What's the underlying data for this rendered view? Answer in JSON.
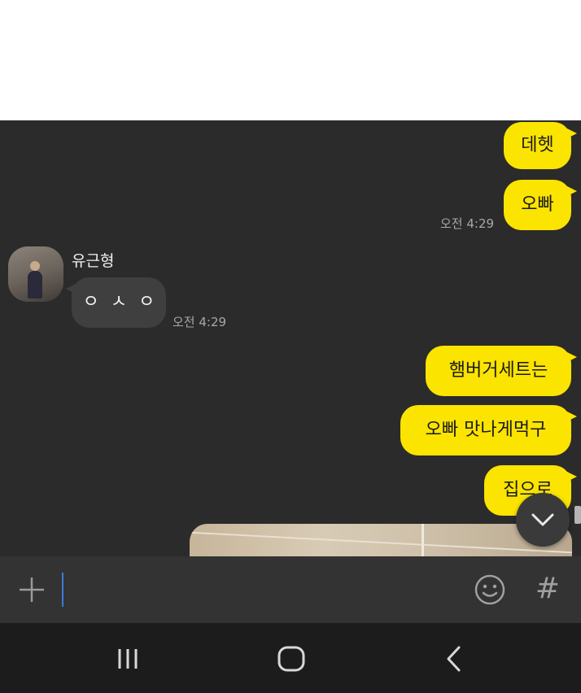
{
  "chat": {
    "messages_me_top": [
      {
        "text": "데헷"
      },
      {
        "text": "오빠",
        "time": "오전 4:29"
      }
    ],
    "other": {
      "sender": "유근형",
      "text": "ㅇㅅㅇ",
      "time": "오전 4:29"
    },
    "messages_me_bottom": [
      {
        "text": "햄버거세트는"
      },
      {
        "text": "오빠 맛나게먹구"
      },
      {
        "text": "집으로"
      }
    ]
  },
  "input": {
    "value": ""
  },
  "icons": {
    "plus": "plus-icon",
    "emoji": "emoji-icon",
    "hashtag": "hashtag-icon",
    "hashtag_glyph": "#",
    "scroll": "chevron-down-icon",
    "nav_recent": "recent-apps-icon",
    "nav_home": "home-icon",
    "nav_back": "back-icon"
  },
  "colors": {
    "my_bubble": "#fbe400",
    "other_bubble": "#3f3f3f",
    "chat_bg": "#2b2b2b",
    "cursor": "#3b7bd8"
  }
}
